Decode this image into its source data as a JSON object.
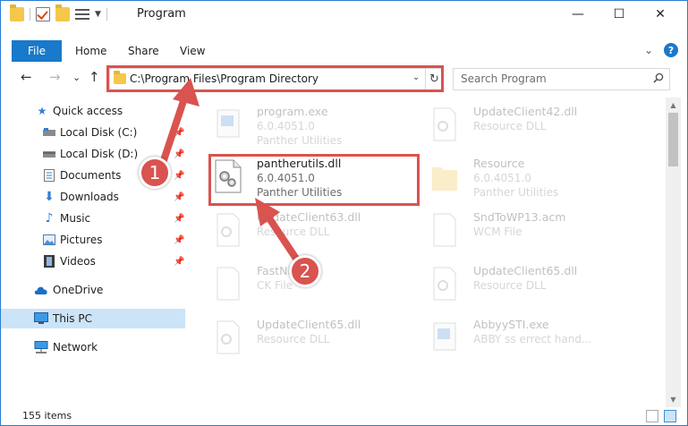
{
  "window": {
    "title": "Program",
    "controls": {
      "minimize": "—",
      "maximize": "☐",
      "close": "✕"
    }
  },
  "ribbon": {
    "tabs": [
      "File",
      "Home",
      "Share",
      "View"
    ],
    "expand_glyph": "⌄",
    "help_glyph": "?"
  },
  "nav": {
    "back": "←",
    "forward": "→",
    "recent": "⌄",
    "up": "↑",
    "address": "C:\\Program Files\\Program Directory",
    "address_dropdown": "⌄",
    "refresh": "↻",
    "search_placeholder": "Search Program"
  },
  "sidebar": {
    "items": [
      {
        "label": "Quick access",
        "icon": "star-icon",
        "pinned": false
      },
      {
        "label": "Local Disk (C:)",
        "icon": "drive-icon",
        "pinned": true
      },
      {
        "label": "Local Disk (D:)",
        "icon": "drive-icon",
        "pinned": true
      },
      {
        "label": "Documents",
        "icon": "documents-icon",
        "pinned": true
      },
      {
        "label": "Downloads",
        "icon": "downloads-icon",
        "pinned": true
      },
      {
        "label": "Music",
        "icon": "music-icon",
        "pinned": true
      },
      {
        "label": "Pictures",
        "icon": "pictures-icon",
        "pinned": true
      },
      {
        "label": "Videos",
        "icon": "videos-icon",
        "pinned": true
      },
      {
        "label": "OneDrive",
        "icon": "cloud-icon",
        "pinned": false
      },
      {
        "label": "This PC",
        "icon": "computer-icon",
        "pinned": false,
        "selected": true
      },
      {
        "label": "Network",
        "icon": "network-icon",
        "pinned": false
      }
    ],
    "pin_glyph": "📌"
  },
  "files": [
    {
      "name": "program.exe",
      "line1": "6.0.4051.0",
      "line2": "Panther Utilities",
      "icon": "app-icon",
      "faded": true
    },
    {
      "name": "UpdateClient42.dll",
      "line1": "Resource DLL",
      "line2": "",
      "icon": "dll-icon",
      "faded": true
    },
    {
      "name": "pantherutils.dll",
      "line1": "6.0.4051.0",
      "line2": "Panther Utilities",
      "icon": "dll-gear-icon",
      "faded": false
    },
    {
      "name": "Resource",
      "line1": "6.0.4051.0",
      "line2": "Panther Utilities",
      "icon": "folder-icon",
      "faded": true
    },
    {
      "name": "UpdateClient63.dll",
      "line1": "Resource DLL",
      "line2": "",
      "icon": "dll-icon",
      "faded": true
    },
    {
      "name": "SndToWP13.acm",
      "line1": "WCM File",
      "line2": "",
      "icon": "file-icon",
      "faded": true
    },
    {
      "name": "FastNi...",
      "line1": "CK File",
      "line2": "",
      "icon": "file-icon",
      "faded": true
    },
    {
      "name": "UpdateClient65.dll",
      "line1": "Resource DLL",
      "line2": "",
      "icon": "dll-icon",
      "faded": true
    },
    {
      "name": "UpdateClient65.dll",
      "line1": "Resource DLL",
      "line2": "",
      "icon": "dll-icon",
      "faded": true
    },
    {
      "name": "AbbyySTI.exe",
      "line1": "ABBY ss errect hand...",
      "line2": "",
      "icon": "app-icon",
      "faded": true
    }
  ],
  "status": {
    "item_count": "155 items"
  },
  "annotations": {
    "step1": "1",
    "step2": "2"
  },
  "colors": {
    "accent": "#1979ca",
    "highlight": "#d9534f",
    "selected": "#cce4f7"
  }
}
